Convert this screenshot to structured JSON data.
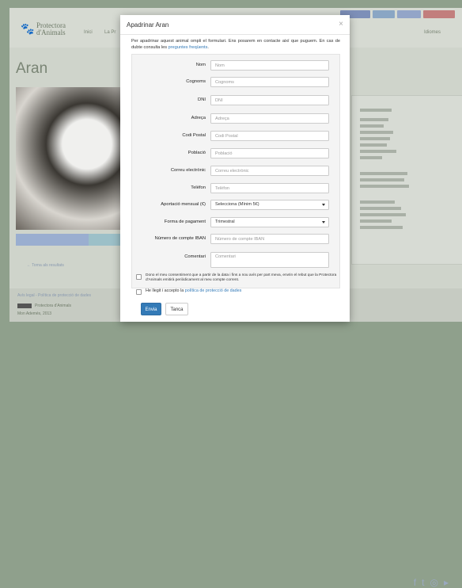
{
  "background": {
    "logo_text_line1": "Protectora",
    "logo_text_line2": "d'Animals",
    "nav_item_1": "Inici",
    "nav_item_2": "La Pr",
    "nav_right": "Idiomes",
    "page_title": "Aran",
    "back_link": "← Torna als resultats",
    "footer_text": "Avís legal - Política de protecció de dades",
    "footer_license": "Protectora d'Animals",
    "footer_address": "Mon Ademés, 2013"
  },
  "modal": {
    "title": "Apadrinar Aran",
    "close_label": "×",
    "intro_text": "Per apadrinar aquest animal ompli el formulari. Ens posarem en contacte així que puguem. En cas de dubte consulta les ",
    "intro_link": "preguntes freqüents",
    "intro_end": ".",
    "fields": [
      {
        "label": "Nom",
        "placeholder": "Nom"
      },
      {
        "label": "Cognoms",
        "placeholder": "Cognoms"
      },
      {
        "label": "DNI",
        "placeholder": "DNI"
      },
      {
        "label": "Adreça",
        "placeholder": "Adreça"
      },
      {
        "label": "Codi Postal",
        "placeholder": "Codi Postal"
      },
      {
        "label": "Població",
        "placeholder": "Població"
      },
      {
        "label": "Correu electrònic",
        "placeholder": "Correu electrònic"
      },
      {
        "label": "Telèfon",
        "placeholder": "Telèfon"
      }
    ],
    "monthly_label": "Aportació mensual (€)",
    "monthly_value": "Selecciona (Mínim 5€)",
    "payment_label": "Forma de pagament",
    "payment_value": "Trimestral",
    "iban_label": "Número de compte IBAN",
    "iban_placeholder": "Número de compte IBAN",
    "comment_label": "Comentari",
    "comment_placeholder": "Comentari",
    "consent_text": "Dono el meu consentiment que a partir de la data i fins a nou avís per part meva, envïin el rebut que la Protectora d'Animals emitirà periòdicament al meu compte corrent.",
    "privacy_text_prefix": "He llegit i accepto la ",
    "privacy_link": "política de protecció de dades",
    "submit_label": "Envia",
    "cancel_label": "Tanca"
  }
}
